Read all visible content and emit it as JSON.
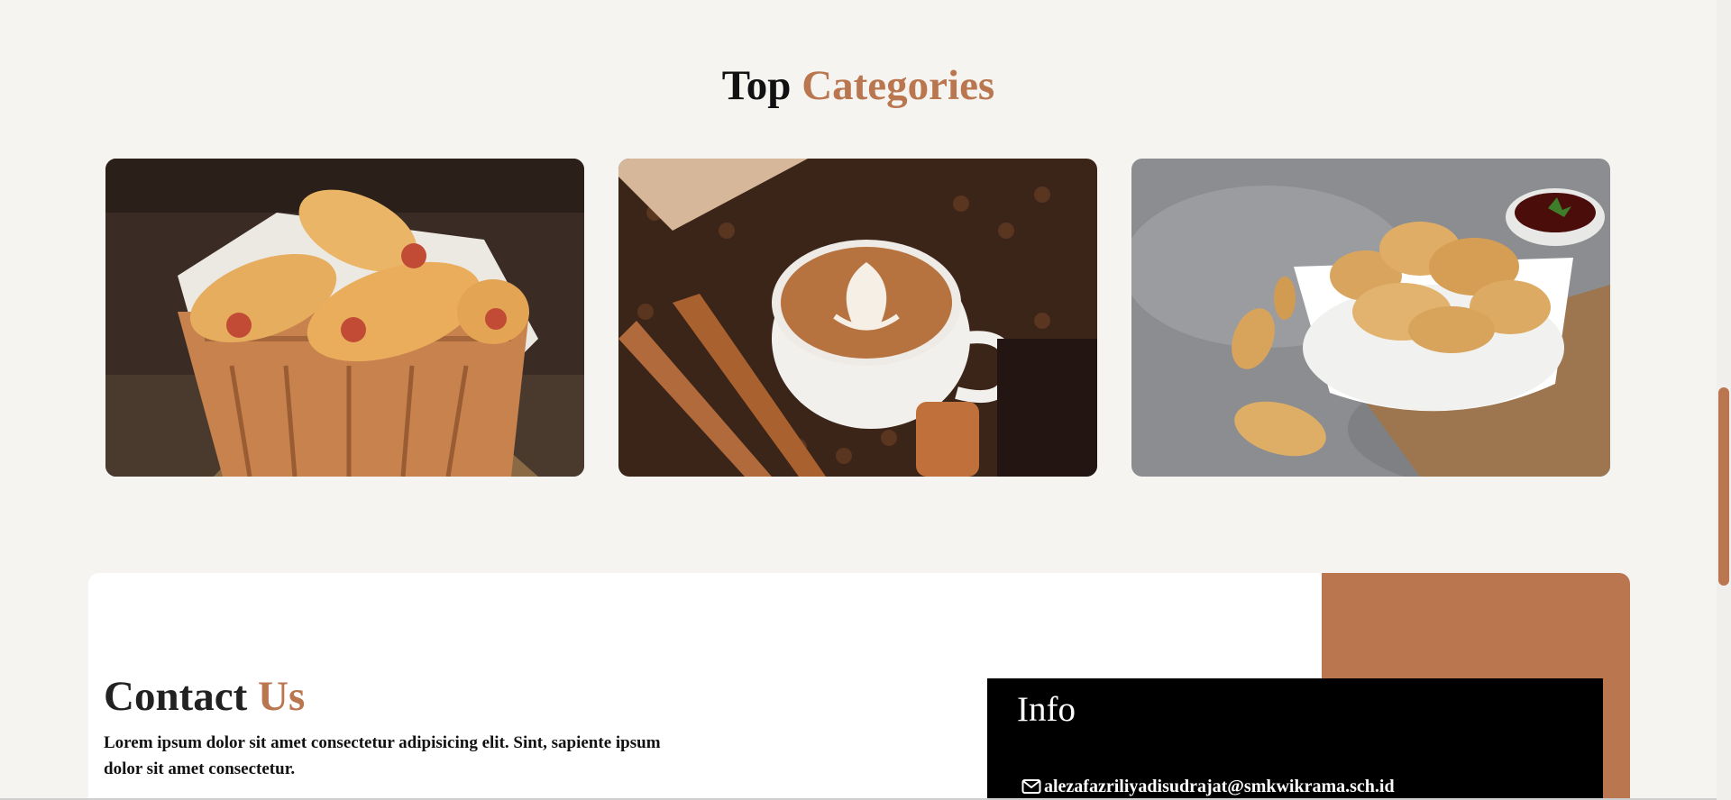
{
  "categories": {
    "title_main": "Top",
    "title_accent": "Categories",
    "items": [
      {
        "image": "bread-basket-image"
      },
      {
        "image": "coffee-latte-image"
      },
      {
        "image": "fried-dumplings-image"
      }
    ]
  },
  "contact": {
    "title_main": "Contact",
    "title_accent": "Us",
    "description": "Lorem ipsum dolor sit amet consectetur adipisicing elit. Sint, sapiente ipsum dolor sit amet consectetur."
  },
  "info": {
    "title": "Info",
    "email": "alezafazriliyadisudrajat@smkwikrama.sch.id",
    "email_icon": "envelope-icon"
  },
  "colors": {
    "accent": "#b9764f",
    "page_background": "#f5f4f1",
    "info_background": "#000000"
  }
}
